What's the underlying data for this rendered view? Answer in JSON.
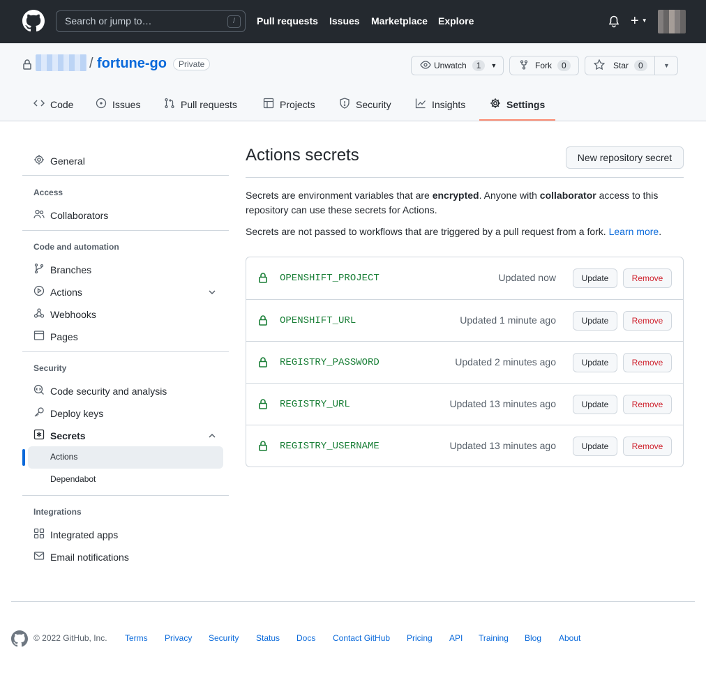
{
  "header": {
    "search_placeholder": "Search or jump to…",
    "search_key": "/",
    "nav": [
      "Pull requests",
      "Issues",
      "Marketplace",
      "Explore"
    ]
  },
  "repo": {
    "separator": "/",
    "name": "fortune-go",
    "visibility": "Private",
    "watch_label": "Unwatch",
    "watch_count": "1",
    "fork_label": "Fork",
    "fork_count": "0",
    "star_label": "Star",
    "star_count": "0"
  },
  "tabs": [
    "Code",
    "Issues",
    "Pull requests",
    "Projects",
    "Security",
    "Insights",
    "Settings"
  ],
  "sidebar": {
    "general": "General",
    "access_heading": "Access",
    "collaborators": "Collaborators",
    "automation_heading": "Code and automation",
    "branches": "Branches",
    "actions": "Actions",
    "webhooks": "Webhooks",
    "pages": "Pages",
    "security_heading": "Security",
    "code_security": "Code security and analysis",
    "deploy_keys": "Deploy keys",
    "secrets": "Secrets",
    "secrets_actions": "Actions",
    "secrets_dependabot": "Dependabot",
    "integrations_heading": "Integrations",
    "integrated_apps": "Integrated apps",
    "email_notifications": "Email notifications"
  },
  "main": {
    "title": "Actions secrets",
    "new_button": "New repository secret",
    "desc1_a": "Secrets are environment variables that are ",
    "desc1_b": "encrypted",
    "desc1_c": ". Anyone with ",
    "desc1_d": "collaborator",
    "desc1_e": " access to this repository can use these secrets for Actions.",
    "desc2": "Secrets are not passed to workflows that are triggered by a pull request from a fork. ",
    "learn_more": "Learn more",
    "period": ".",
    "update_label": "Update",
    "remove_label": "Remove",
    "secrets": [
      {
        "name": "OPENSHIFT_PROJECT",
        "updated": "Updated now"
      },
      {
        "name": "OPENSHIFT_URL",
        "updated": "Updated 1 minute ago"
      },
      {
        "name": "REGISTRY_PASSWORD",
        "updated": "Updated 2 minutes ago"
      },
      {
        "name": "REGISTRY_URL",
        "updated": "Updated 13 minutes ago"
      },
      {
        "name": "REGISTRY_USERNAME",
        "updated": "Updated 13 minutes ago"
      }
    ]
  },
  "footer": {
    "copyright": "© 2022 GitHub, Inc.",
    "links": [
      "Terms",
      "Privacy",
      "Security",
      "Status",
      "Docs",
      "Contact GitHub",
      "Pricing",
      "API",
      "Training",
      "Blog",
      "About"
    ]
  },
  "colors": {
    "header_bg": "#24292f",
    "accent": "#0969da",
    "secret_name": "#1a7f37",
    "danger": "#cf222e",
    "tab_underline": "#fd8c73"
  }
}
